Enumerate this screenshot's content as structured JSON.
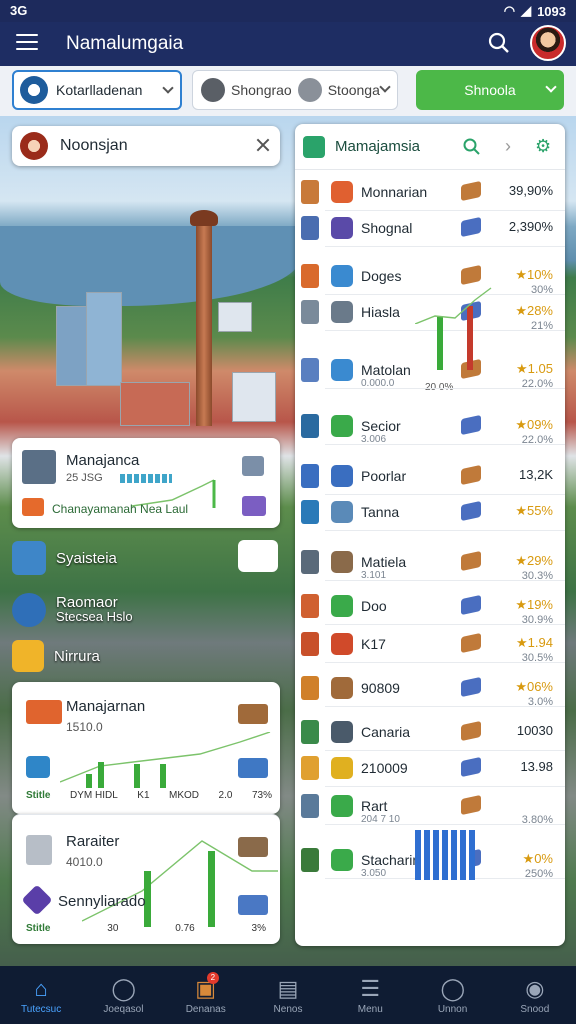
{
  "status_bar": {
    "time": "3G",
    "clock": "1093"
  },
  "app_bar": {
    "title": "Namalumgaia"
  },
  "filters": {
    "location_select": "Kotarlladenan",
    "chip_a": "Shongrao",
    "chip_b": "Stoonga",
    "primary_select": "Shnoola"
  },
  "location_card": {
    "label": "Noonsjan"
  },
  "manage_card": {
    "title": "Manajanca",
    "value": "25 JSG",
    "footer": "Chanayamanah Nea Laul"
  },
  "left_links": [
    {
      "label": "Syaisteia"
    },
    {
      "label": "Raomaor",
      "sub": "Stecsea Hslo"
    },
    {
      "label": "Nirrura"
    }
  ],
  "stats_card_1": {
    "title": "Manajarnan",
    "sub": "1510.0",
    "footer": [
      "Stitle",
      "DYM HIDL",
      "K1",
      "MKOD",
      "2.0",
      "73%"
    ]
  },
  "stats_card_2": {
    "title": "Raraiter",
    "sub": "4010.0",
    "title2": "Sennyliarado",
    "footer": [
      "Stitle",
      "30",
      "0.76",
      "3%"
    ]
  },
  "panel": {
    "title": "Mamajamsia",
    "rows": [
      {
        "label": "Monnarian",
        "value": "39,90%",
        "value2": ""
      },
      {
        "label": "Shognal",
        "value": "2,390%",
        "value2": ""
      },
      {
        "label": "Doges",
        "value": "★10%",
        "value2": "30%"
      },
      {
        "label": "Hiasla",
        "value": "★28%",
        "value2": "21%"
      },
      {
        "label": "Matolan",
        "sub": "0.000.0",
        "mid": "20  0%",
        "value": "★1.05",
        "value2": "22.0%"
      },
      {
        "label": "Secior",
        "sub": "3.006",
        "value": "★09%",
        "value2": "22.0%"
      },
      {
        "label": "Poorlar",
        "value": "13,2K",
        "value2": ""
      },
      {
        "label": "Tanna",
        "value": "★55%",
        "value2": ""
      },
      {
        "label": "Matiela",
        "sub": "3.101",
        "value": "★29%",
        "value2": "30.3%"
      },
      {
        "label": "Doo",
        "value": "★19%",
        "value2": "30.9%"
      },
      {
        "label": "K17",
        "value": "★1.94",
        "value2": "30.5%"
      },
      {
        "label": "90809",
        "value": "★06%",
        "value2": "3.0%"
      },
      {
        "label": "Canaria",
        "value": "10030",
        "value2": ""
      },
      {
        "label": "210009",
        "value": "13.98",
        "value2": ""
      },
      {
        "label": "Rart",
        "sub": "204 7 10",
        "value": "",
        "value2": "3.80%"
      },
      {
        "label": "Stacharimar",
        "sub": "3.050",
        "value": "★0%",
        "value2": "250%"
      }
    ]
  },
  "bottom_nav": [
    {
      "label": "Tutecsuc",
      "icon": "home-icon"
    },
    {
      "label": "Joeqasol",
      "icon": "circle-icon"
    },
    {
      "label": "Denanas",
      "icon": "folder-icon",
      "badge": "2"
    },
    {
      "label": "Nenos",
      "icon": "news-icon"
    },
    {
      "label": "Menu",
      "icon": "list-icon"
    },
    {
      "label": "Unnon",
      "icon": "circle-icon"
    },
    {
      "label": "Snood",
      "icon": "profile-icon"
    }
  ],
  "colors": {
    "appbar": "#1e2d63",
    "accent": "#4cb848",
    "link": "#2f80d1",
    "gold": "#d89a10"
  }
}
